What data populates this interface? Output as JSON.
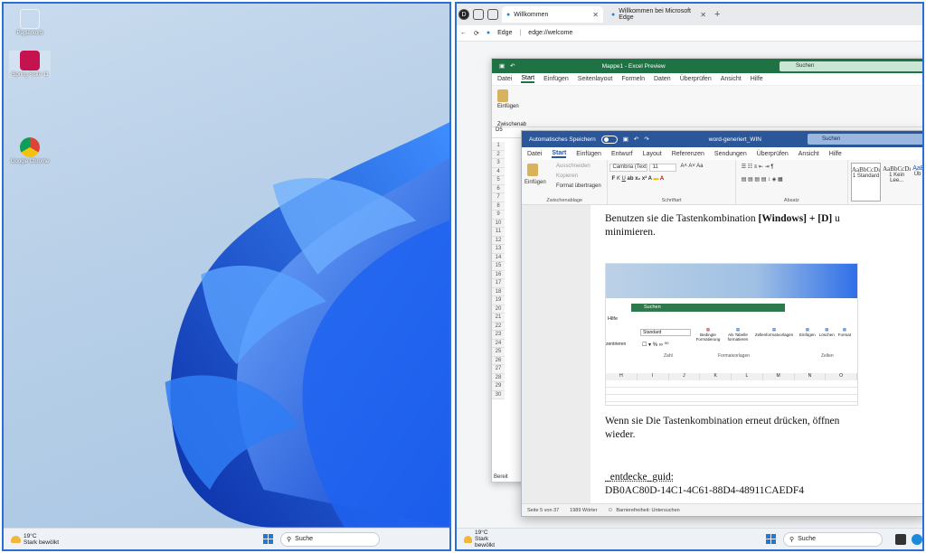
{
  "desktop": {
    "icons": [
      {
        "label": "Papierkorb",
        "icon": "recycle-bin-icon"
      },
      {
        "label": "iSpring Suite 11",
        "icon": "ispring-icon"
      },
      {
        "label": "Google Chrome",
        "icon": "chrome-icon"
      }
    ],
    "weather": {
      "temp": "19°C",
      "desc": "Stark bewölkt"
    },
    "search_label": "Suche"
  },
  "edge": {
    "tabs": [
      {
        "label": "Willkommen"
      },
      {
        "label": "Willkommen bei Microsoft Edge"
      }
    ],
    "new_tab": "+",
    "site_label": "Edge",
    "url": "edge://welcome"
  },
  "excel": {
    "title": "Mappe1 - Excel Preview",
    "search": "Suchen",
    "menu": [
      "Datei",
      "Start",
      "Einfügen",
      "Seitenlayout",
      "Formeln",
      "Daten",
      "Überprüfen",
      "Ansicht",
      "Hilfe"
    ],
    "active_menu": "Start",
    "cell_ref": "D5",
    "group_label": "Zwischenab",
    "paste_label": "Einfügen",
    "rows": [
      "1",
      "2",
      "3",
      "4",
      "5",
      "6",
      "7",
      "8",
      "9",
      "10",
      "11",
      "12",
      "13",
      "14",
      "15",
      "16",
      "17",
      "18",
      "19",
      "20",
      "21",
      "22",
      "23",
      "24",
      "25",
      "26",
      "27",
      "28",
      "29",
      "30"
    ],
    "sheet_tab": "Bereit"
  },
  "word": {
    "autosave": "Automatisches Speichern",
    "title": "word-generiert_WIN",
    "search": "Suchen",
    "menu": [
      "Datei",
      "Start",
      "Einfügen",
      "Entwurf",
      "Layout",
      "Referenzen",
      "Sendungen",
      "Überprüfen",
      "Ansicht",
      "Hilfe"
    ],
    "active_menu": "Start",
    "clipboard": {
      "paste": "Einfügen",
      "cut": "Ausschneiden",
      "copy": "Kopieren",
      "format": "Format übertragen",
      "label": "Zwischenablage"
    },
    "font": {
      "name": "Cambria (Text",
      "size": "11",
      "label": "Schriftart"
    },
    "paragraph_label": "Absatz",
    "styles": [
      {
        "preview": "AaBbCcDı",
        "name": "1 Standard"
      },
      {
        "preview": "AaBbCcDı",
        "name": "1 Kein Lee..."
      },
      {
        "preview": "AaB",
        "name": "Üb"
      }
    ],
    "para1": "Benutzen sie die Tastenkombination ",
    "para1_bold": "[Windows] + [D]",
    "para1_end": " u",
    "para1_line2": "minimieren.",
    "para2": "Wenn sie Die Tastenkombination erneut drücken, öffnen",
    "para2_line2": "wieder.",
    "guid_label": "_entdecke_guid:",
    "guid_value": "DB0AC80D-14C1-4C61-88D4-48911CAEDF4",
    "status": {
      "page": "Seite 5 von 37",
      "words": "1989 Wörter",
      "access": "Barrierefreiheit: Untersuchen"
    }
  },
  "inner_screenshot": {
    "search": "Suchen",
    "menu": "Hilfe",
    "number_format": "Standard",
    "number_label": "Zahl",
    "font_label": "zentrieren",
    "cond_format": "Bedingte Formatierung",
    "table_format": "Als Tabelle formatieren",
    "cell_styles": "Zellenformatvorlagen",
    "styles_label": "Formatvorlagen",
    "insert": "Einfügen",
    "delete": "Löschen",
    "format": "Format",
    "cells_label": "Zellen",
    "columns": [
      "H",
      "I",
      "J",
      "K",
      "L",
      "M",
      "N",
      "O"
    ]
  }
}
